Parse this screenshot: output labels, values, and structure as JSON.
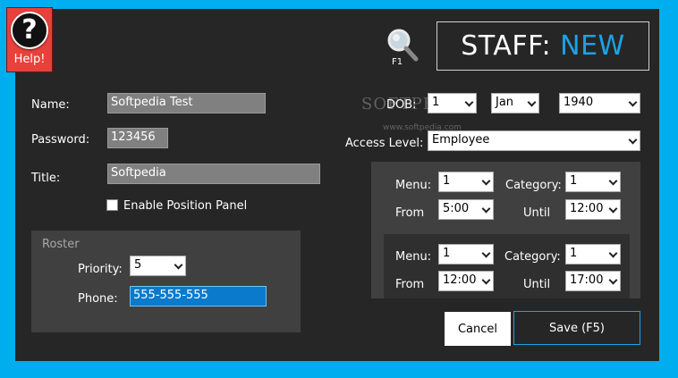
{
  "help": {
    "label": "Help!",
    "glyph": "?"
  },
  "search": {
    "hotkey": "F1"
  },
  "header": {
    "title": "STAFF:",
    "mode": "NEW"
  },
  "form": {
    "name_label": "Name:",
    "name_value": "Softpedia Test",
    "password_label": "Password:",
    "password_value": "123456",
    "title_label": "Title:",
    "title_value": "Softpedia",
    "position_panel_label": "Enable Position Panel",
    "dob_label": "DOB:",
    "dob_day": "1",
    "dob_month": "Jan",
    "dob_year": "1940",
    "access_label": "Access Level:",
    "access_value": "Employee"
  },
  "roster": {
    "title": "Roster",
    "priority_label": "Priority:",
    "priority_value": "5",
    "phone_label": "Phone:",
    "phone_value": "555-555-555"
  },
  "schedule": [
    {
      "menu_label": "Menu:",
      "menu_value": "1",
      "category_label": "Category:",
      "category_value": "1",
      "from_label": "From",
      "from_value": "5:00",
      "until_label": "Until",
      "until_value": "12:00"
    },
    {
      "menu_label": "Menu:",
      "menu_value": "1",
      "category_label": "Category:",
      "category_value": "1",
      "from_label": "From",
      "from_value": "12:00",
      "until_label": "Until",
      "until_value": "17:00"
    }
  ],
  "watermark": {
    "text": "SOFTPEDIA",
    "sub": "www.softpedia.com"
  },
  "actions": {
    "cancel": "Cancel",
    "save": "Save (F5)"
  },
  "colors": {
    "background": "#00aeef",
    "panel": "#262626",
    "accent": "#1aa3e8",
    "help": "#e8403a"
  }
}
